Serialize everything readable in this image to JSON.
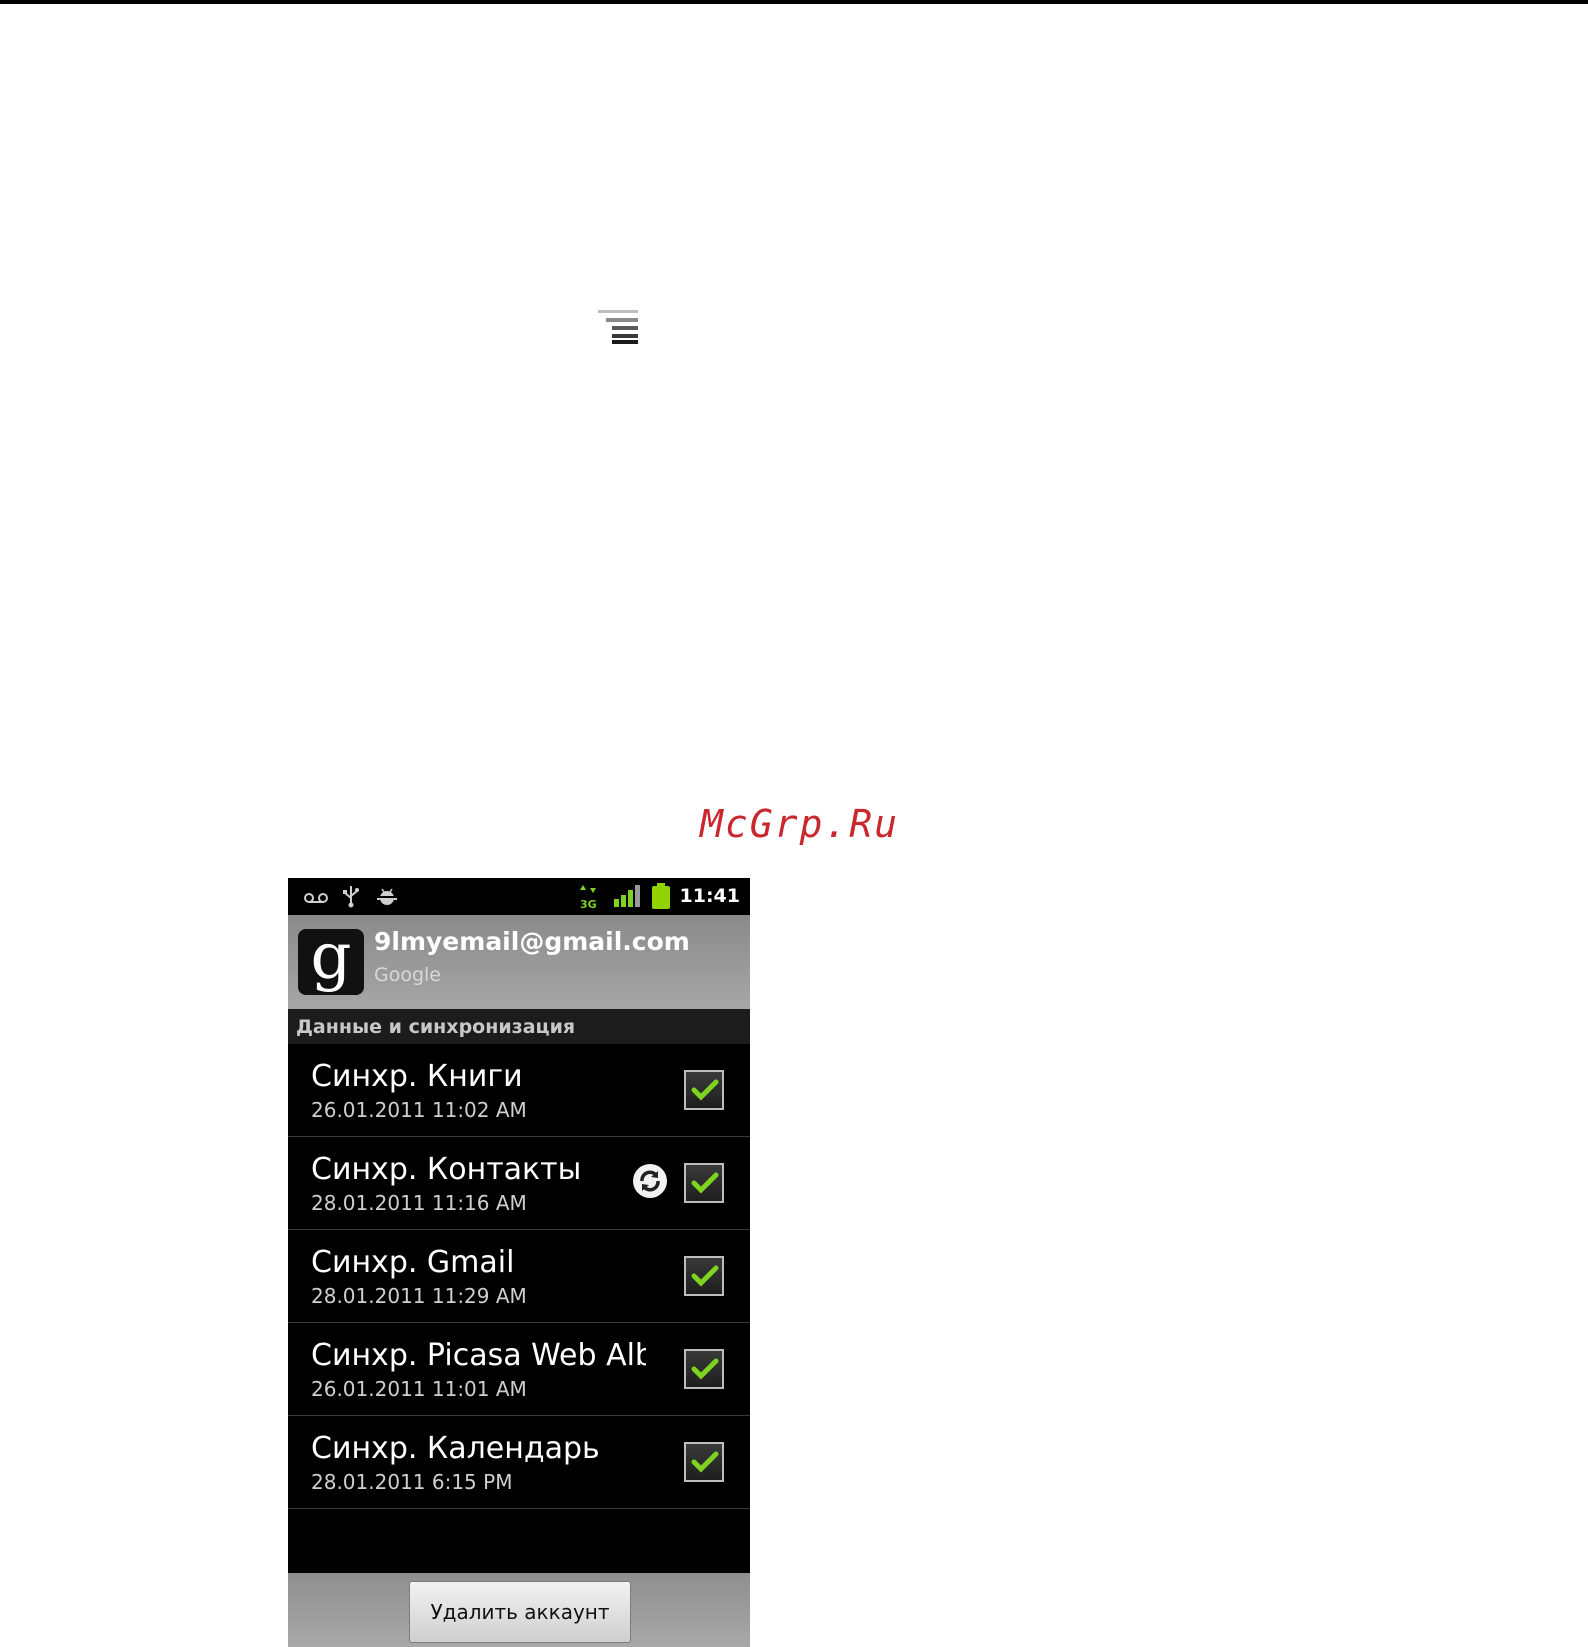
{
  "watermark": "McGrp.Ru",
  "status_bar": {
    "time": "11:41",
    "network": "3G",
    "icons": [
      "voicemail-icon",
      "usb-icon",
      "android-debug-icon",
      "data-3g-icon",
      "signal-icon",
      "battery-icon"
    ]
  },
  "account": {
    "avatar_letter": "g",
    "email": "9lmyemail@gmail.com",
    "type": "Google"
  },
  "section_header": "Данные и синхронизация",
  "sync_items": [
    {
      "title": "Синхр. Книги",
      "date": "26.01.2011 11:02 AM",
      "checked": true,
      "syncing": false
    },
    {
      "title": "Синхр. Контакты",
      "date": "28.01.2011 11:16 AM",
      "checked": true,
      "syncing": true
    },
    {
      "title": "Синхр. Gmail",
      "date": "28.01.2011 11:29 AM",
      "checked": true,
      "syncing": false
    },
    {
      "title": "Синхр. Picasa Web Albums",
      "date": "26.01.2011 11:01 AM",
      "checked": true,
      "syncing": false
    },
    {
      "title": "Синхр. Календарь",
      "date": "28.01.2011 6:15 PM",
      "checked": true,
      "syncing": false
    }
  ],
  "remove_button_label": "Удалить аккаунт",
  "colors": {
    "check": "#7ed321",
    "battery": "#8fd400",
    "watermark": "#c8282e"
  }
}
